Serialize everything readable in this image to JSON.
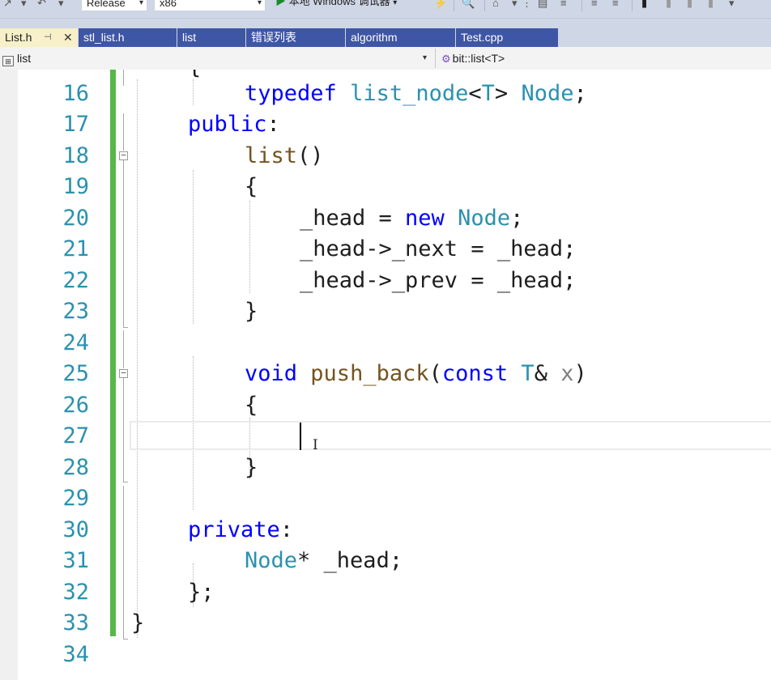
{
  "toolbar": {
    "config": "Release",
    "platform": "x86",
    "run_label": "本地 Windows 调试器"
  },
  "tabs": [
    {
      "label": "List.h",
      "active": true
    },
    {
      "label": "stl_list.h",
      "active": false
    },
    {
      "label": "list",
      "active": false
    },
    {
      "label": "错误列表",
      "active": false
    },
    {
      "label": "algorithm",
      "active": false
    },
    {
      "label": "Test.cpp",
      "active": false
    }
  ],
  "navbar": {
    "scope": "list",
    "member": "bit::list<T>"
  },
  "editor": {
    "line_numbers": [
      "16",
      "17",
      "18",
      "19",
      "20",
      "21",
      "22",
      "23",
      "24",
      "25",
      "26",
      "27",
      "28",
      "29",
      "30",
      "31",
      "32",
      "33",
      "34"
    ],
    "code": {
      "l15": "{",
      "l16_kw": "typedef",
      "l16_type": "list_node",
      "l16_lt": "<",
      "l16_t": "T",
      "l16_gt": ">",
      "l16_node": "Node",
      "l16_semi": ";",
      "l17_kw": "public",
      "l17_colon": ":",
      "l18_fn": "list",
      "l18_parens": "()",
      "l19": "{",
      "l20_a": "_head = ",
      "l20_kw": "new",
      "l20_type": "Node",
      "l20_semi": ";",
      "l21": "_head->_next = _head;",
      "l22": "_head->_prev = _head;",
      "l23": "}",
      "l25_kw": "void",
      "l25_fn": "push_back",
      "l25_open": "(",
      "l25_const": "const",
      "l25_t": "T",
      "l25_amp": "& ",
      "l25_x": "x",
      "l25_close": ")",
      "l26": "{",
      "l28": "}",
      "l30_kw": "private",
      "l30_colon": ":",
      "l31_type": "Node",
      "l31_rest": "* _head;",
      "l32": "};",
      "l33": "}"
    }
  },
  "colors": {
    "keyword": "#0000ff",
    "type": "#2b91af",
    "function": "#74531f",
    "param": "#808080",
    "change_bar": "#57b848",
    "tab_bg": "#3e56a6",
    "active_tab_bg": "#f7f0c8"
  },
  "icons": [
    "run-icon",
    "pin-icon",
    "close-icon",
    "class-icon",
    "member-icon",
    "bookmark-icon"
  ]
}
